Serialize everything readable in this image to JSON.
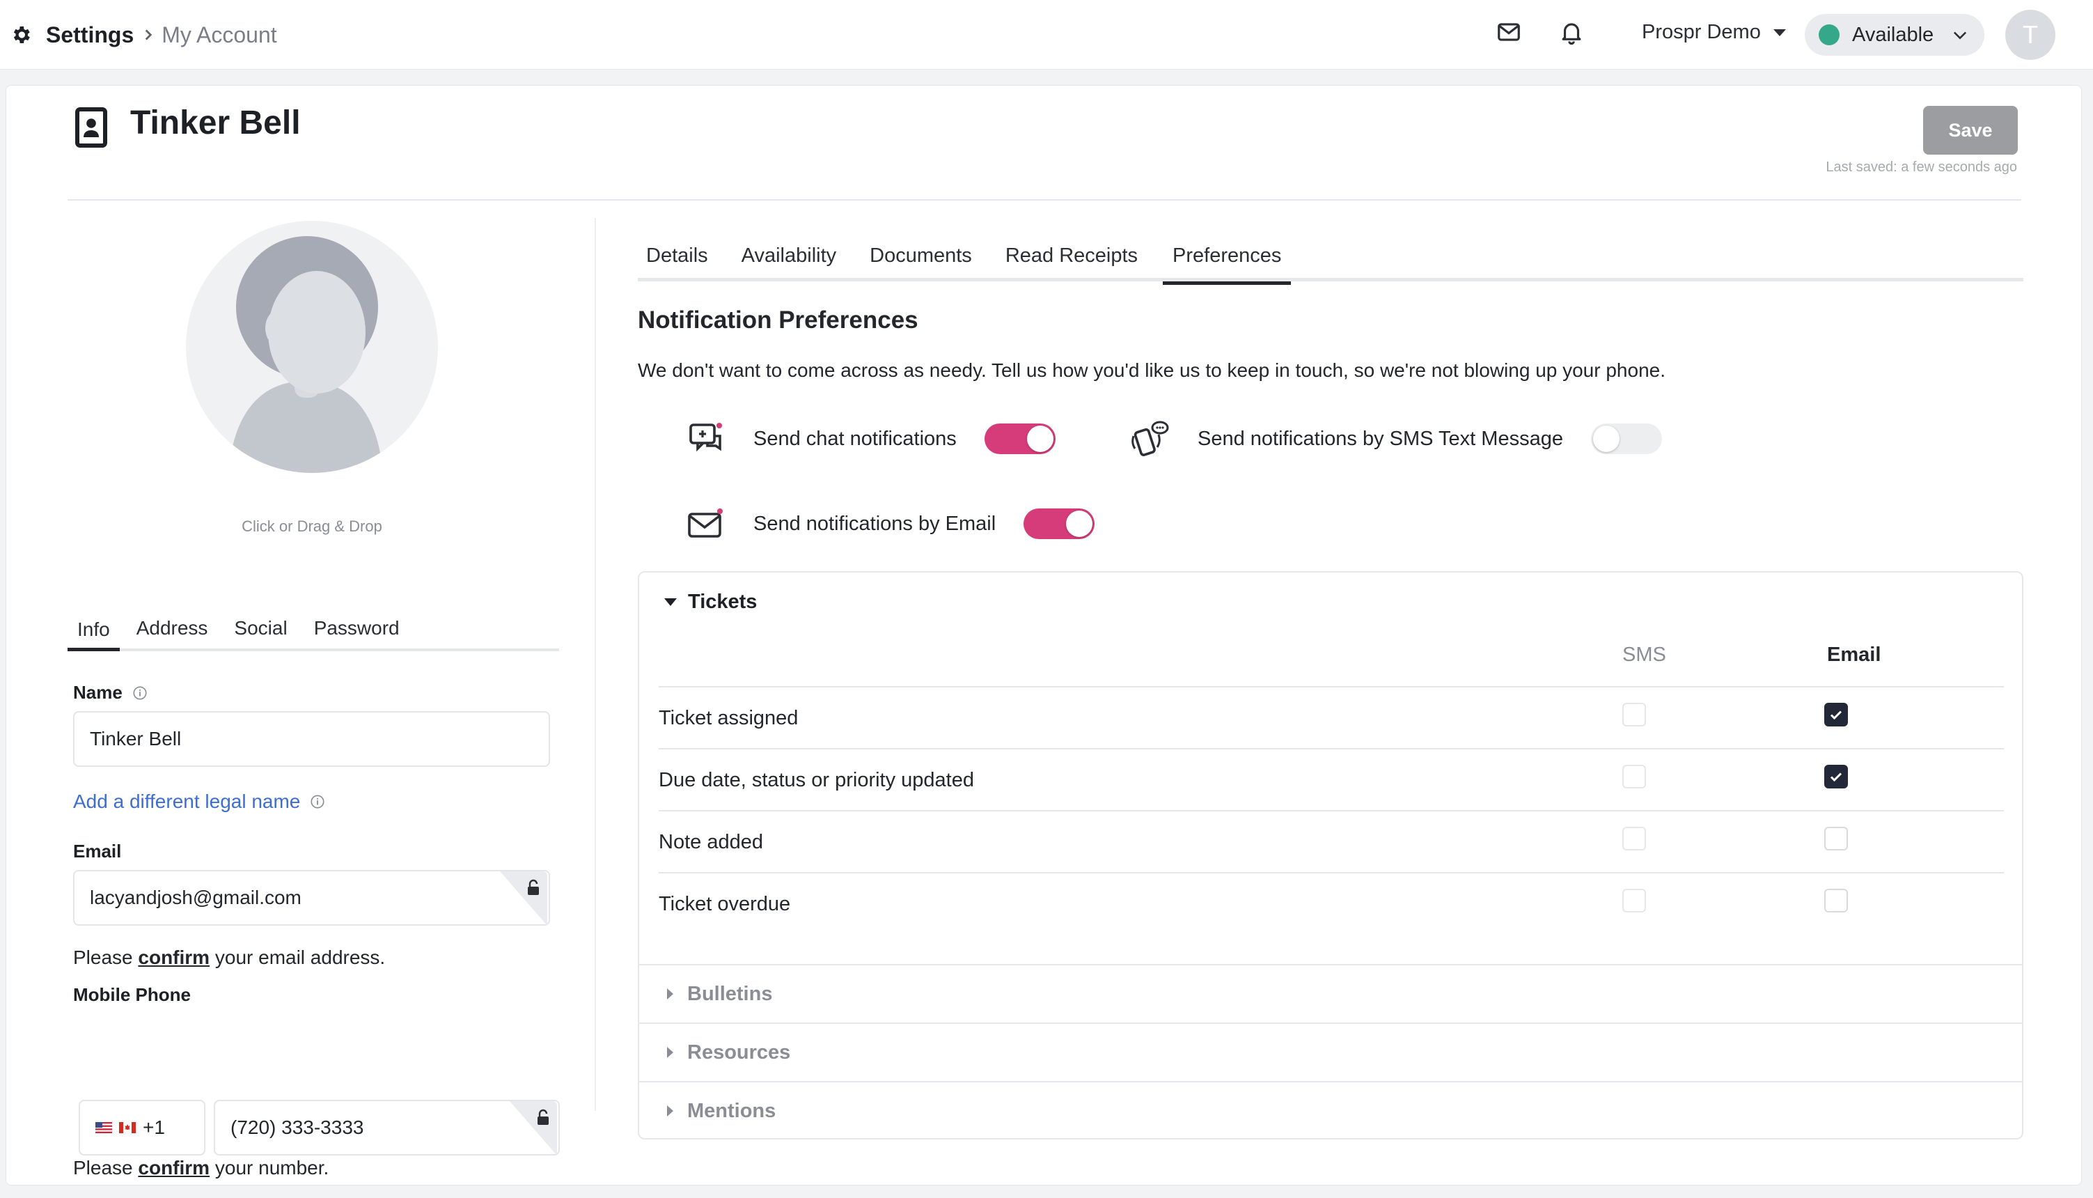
{
  "breadcrumb": {
    "root": "Settings",
    "current": "My Account"
  },
  "topbar": {
    "org_name": "Prospr Demo",
    "status": "Available",
    "status_color": "#35a88a",
    "avatar_initial": "T"
  },
  "profile": {
    "name": "Tinker Bell",
    "save_label": "Save",
    "last_saved": "Last saved: a few seconds ago",
    "upload_hint": "Click or Drag & Drop"
  },
  "left_tabs": [
    {
      "label": "Info",
      "active": true
    },
    {
      "label": "Address"
    },
    {
      "label": "Social"
    },
    {
      "label": "Password"
    }
  ],
  "info_form": {
    "name_label": "Name",
    "name_value": "Tinker Bell",
    "legal_name_link": "Add a different legal name",
    "email_label": "Email",
    "email_value": "lacyandjosh@gmail.com",
    "email_confirm_prefix": "Please ",
    "email_confirm_link": "confirm",
    "email_confirm_suffix": " your email address.",
    "phone_label": "Mobile Phone",
    "phone_country_code": "+1",
    "phone_value": "(720) 333-3333",
    "phone_confirm_prefix": "Please ",
    "phone_confirm_link": "confirm",
    "phone_confirm_suffix": " your number."
  },
  "main_tabs": [
    {
      "label": "Details"
    },
    {
      "label": "Availability"
    },
    {
      "label": "Documents"
    },
    {
      "label": "Read Receipts"
    },
    {
      "label": "Preferences",
      "active": true
    }
  ],
  "notifications": {
    "title": "Notification Preferences",
    "description": "We don't want to come across as needy. Tell us how you'd like us to keep in touch, so we're not blowing up your phone.",
    "chat_label": "Send chat notifications",
    "chat_on": true,
    "sms_label": "Send notifications by SMS Text Message",
    "sms_on": false,
    "email_label": "Send notifications by Email",
    "email_on": true,
    "accent_color": "#d63c7a"
  },
  "tickets": {
    "title": "Tickets",
    "col_sms": "SMS",
    "col_email": "Email",
    "rows": [
      {
        "label": "Ticket assigned",
        "sms": false,
        "email": true
      },
      {
        "label": "Due date, status or priority updated",
        "sms": false,
        "email": true
      },
      {
        "label": "Note added",
        "sms": false,
        "email": false
      },
      {
        "label": "Ticket overdue",
        "sms": false,
        "email": false
      }
    ]
  },
  "collapsed_sections": [
    "Bulletins",
    "Resources",
    "Mentions"
  ]
}
